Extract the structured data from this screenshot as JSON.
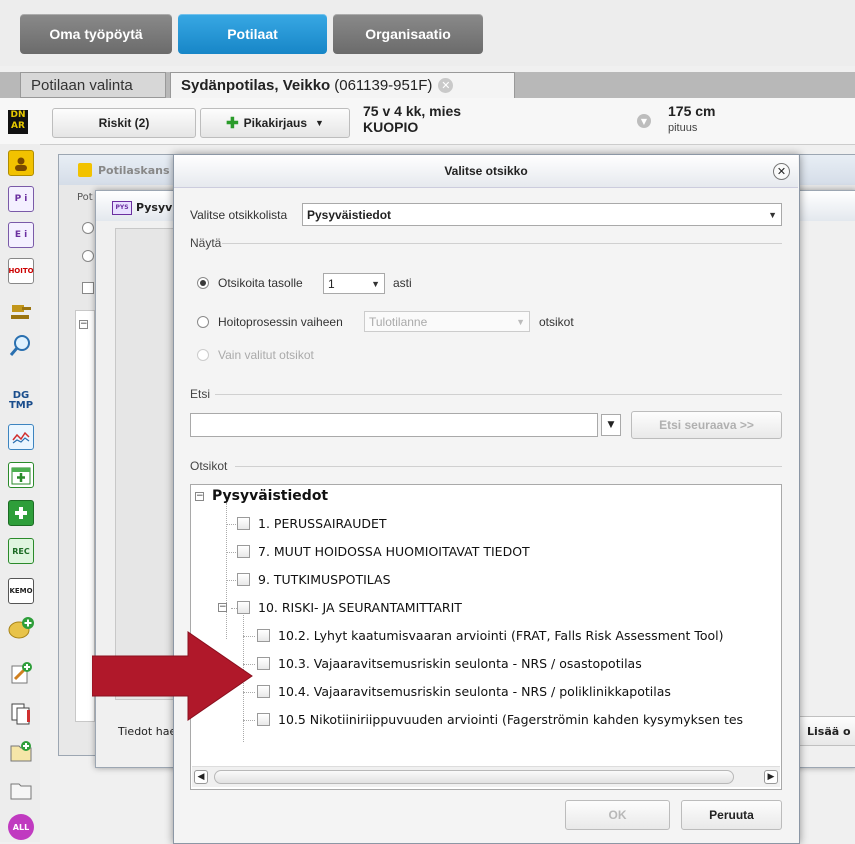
{
  "nav": {
    "oma": "Oma työpöytä",
    "potilaat": "Potilaat",
    "organisaatio": "Organisaatio"
  },
  "tabs": {
    "select": "Potilaan valinta",
    "patient_name": "Sydänpotilas, Veikko",
    "patient_id": "(061139-951F)"
  },
  "infobar": {
    "riskit": "Riskit (2)",
    "pikakirjaus": "Pikakirjaus",
    "age_line": "75 v 4 kk, mies",
    "city": "KUOPIO",
    "height_value": "175 cm",
    "height_label": "pituus"
  },
  "left_icons": {
    "dnar": "DN AR",
    "dgtmp": "DG TMP",
    "rec": "REC",
    "kemo": "KEMO",
    "all": "ALL",
    "hoito": "HOITO"
  },
  "background": {
    "window1_title": "Potilaskans",
    "window1_label": "Pot",
    "window2_title": "Pysyv",
    "tiedot": "Tiedot hae",
    "lisaa": "Lisää o"
  },
  "dialog": {
    "title": "Valitse otsikko",
    "list_label": "Valitse otsikkolista",
    "list_value": "Pysyväistiedot",
    "nayta": "Näytä",
    "radio1_label": "Otsikoita tasolle",
    "radio1_value": "1",
    "radio1_suffix": "asti",
    "radio2_label": "Hoitoprosessin vaiheen",
    "radio2_value": "Tulotilanne",
    "radio2_suffix": "otsikot",
    "radio3_label": "Vain valitut otsikot",
    "etsi": "Etsi",
    "search_value": "",
    "search_next": "Etsi seuraava >>",
    "otsikot": "Otsikot",
    "tree_root": "Pysyväistiedot",
    "tree_items": [
      "1. PERUSSAIRAUDET",
      "7. MUUT HOIDOSSA HUOMIOITAVAT TIEDOT",
      "9. TUTKIMUSPOTILAS",
      "10. RISKI- JA SEURANTAMITTARIT",
      "10.2. Lyhyt kaatumisvaaran arviointi (FRAT, Falls Risk Assessment Tool)",
      "10.3. Vajaaravitsemusriskin seulonta - NRS / osastopotilas",
      "10.4. Vajaaravitsemusriskin seulonta - NRS / poliklinikkapotilas",
      "10.5 Nikotiiniriippuvuuden arviointi (Fagerströmin kahden kysymyksen tes"
    ],
    "ok": "OK",
    "cancel": "Peruuta"
  },
  "colors": {
    "accent": "#1f93d6",
    "arrow": "#b0182a"
  }
}
